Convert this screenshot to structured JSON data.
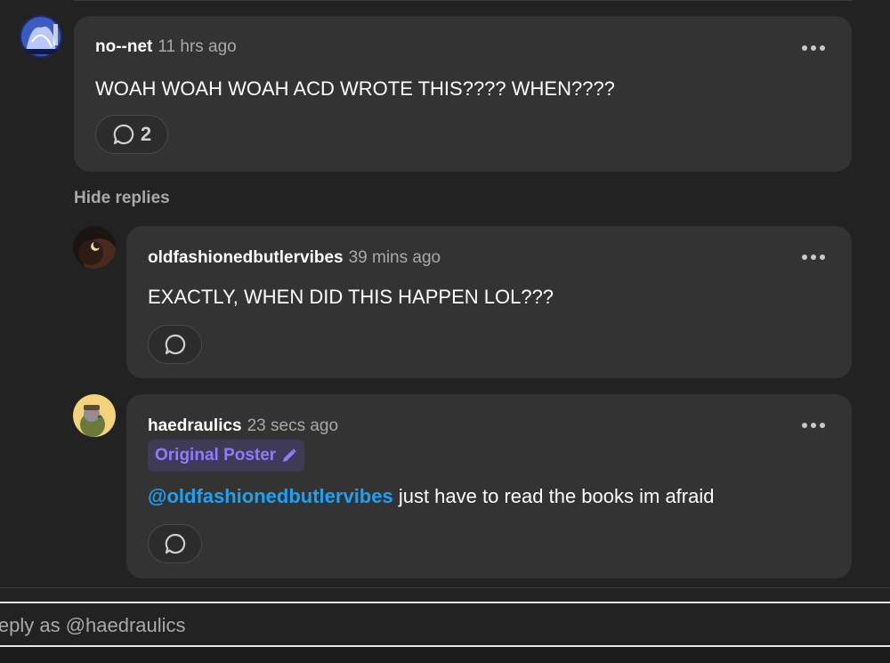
{
  "comments": [
    {
      "username": "no--net",
      "time": "11 hrs ago",
      "text": "WOAH WOAH WOAH ACD WROTE THIS???? WHEN????",
      "reply_count": "2"
    }
  ],
  "hide_replies_label": "Hide replies",
  "replies": [
    {
      "username": "oldfashionedbutlervibes",
      "time": "39 mins ago",
      "text": "EXACTLY, WHEN DID THIS HAPPEN LOL???"
    },
    {
      "username": "haedraulics",
      "time": "23 secs ago",
      "badge": "Original Poster",
      "mention": "@oldfashionedbutlervibes",
      "text": " just have to read the books im afraid"
    }
  ],
  "reply_input": {
    "placeholder": "Reply as @haedraulics"
  },
  "colors": {
    "background": "#222222",
    "card": "#333333",
    "mention": "#1da1f2",
    "badge_text": "#8e7cff",
    "badge_bg": "#3f3a55"
  }
}
